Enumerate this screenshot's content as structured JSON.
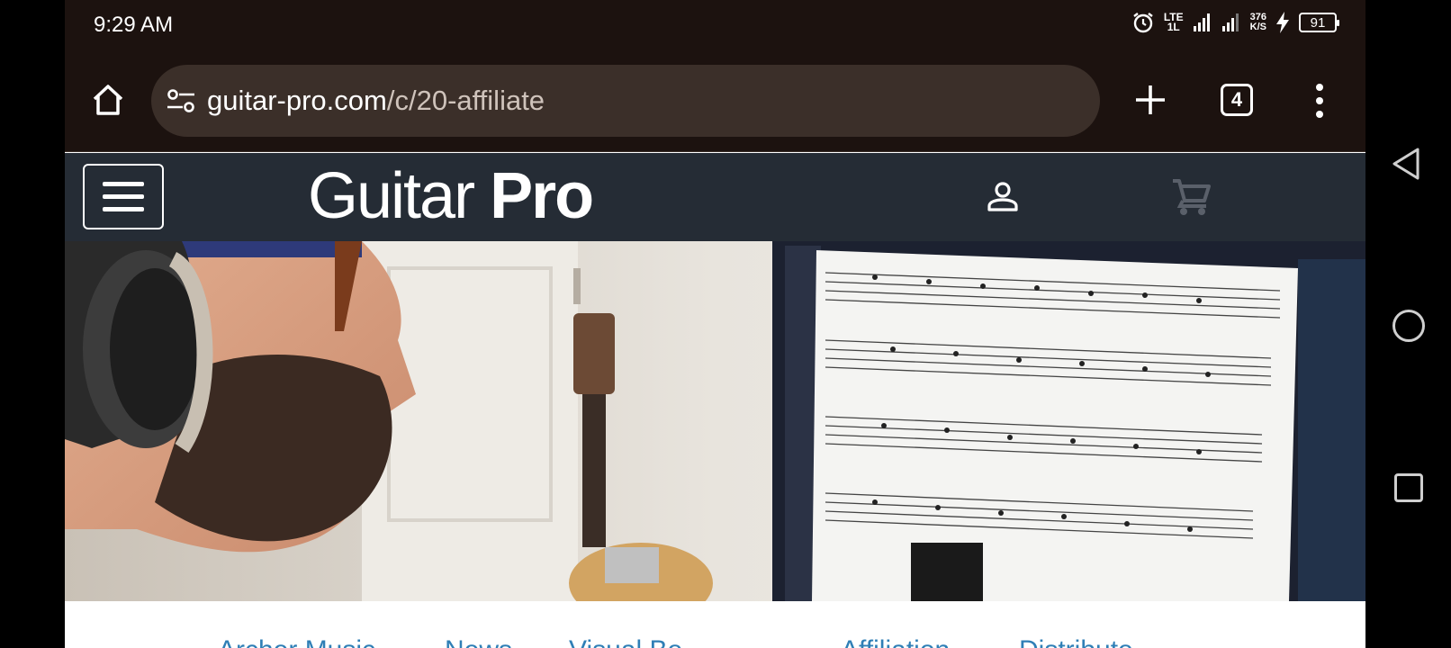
{
  "status_bar": {
    "time": "9:29 AM",
    "network_label": "LTE",
    "network_sub": "1L",
    "speed_value": "376",
    "speed_unit": "K/S",
    "battery": "91",
    "icons": [
      "alarm-icon",
      "signal-icon",
      "signal-icon",
      "charging-icon",
      "battery-icon"
    ]
  },
  "browser": {
    "url_domain": "guitar-pro.com",
    "url_path": "/c/20-affiliate",
    "tab_count": "4",
    "icons": [
      "home-icon",
      "site-settings-icon",
      "plus-icon",
      "tabs-icon",
      "more-vert-icon"
    ]
  },
  "site": {
    "logo_light": "Guitar ",
    "logo_bold": "Pro",
    "icons": [
      "menu-icon",
      "account-icon",
      "cart-icon"
    ],
    "cart_color": "#5a606a",
    "header_color": "#252c35"
  },
  "subnav": {
    "items": [
      "Archer Music",
      "News",
      "Visual Bo",
      "Affiliation",
      "Distributo"
    ],
    "link_color": "#2f7fb6"
  },
  "android_nav": {
    "icons": [
      "back-icon",
      "home-circle-icon",
      "recents-icon"
    ]
  }
}
